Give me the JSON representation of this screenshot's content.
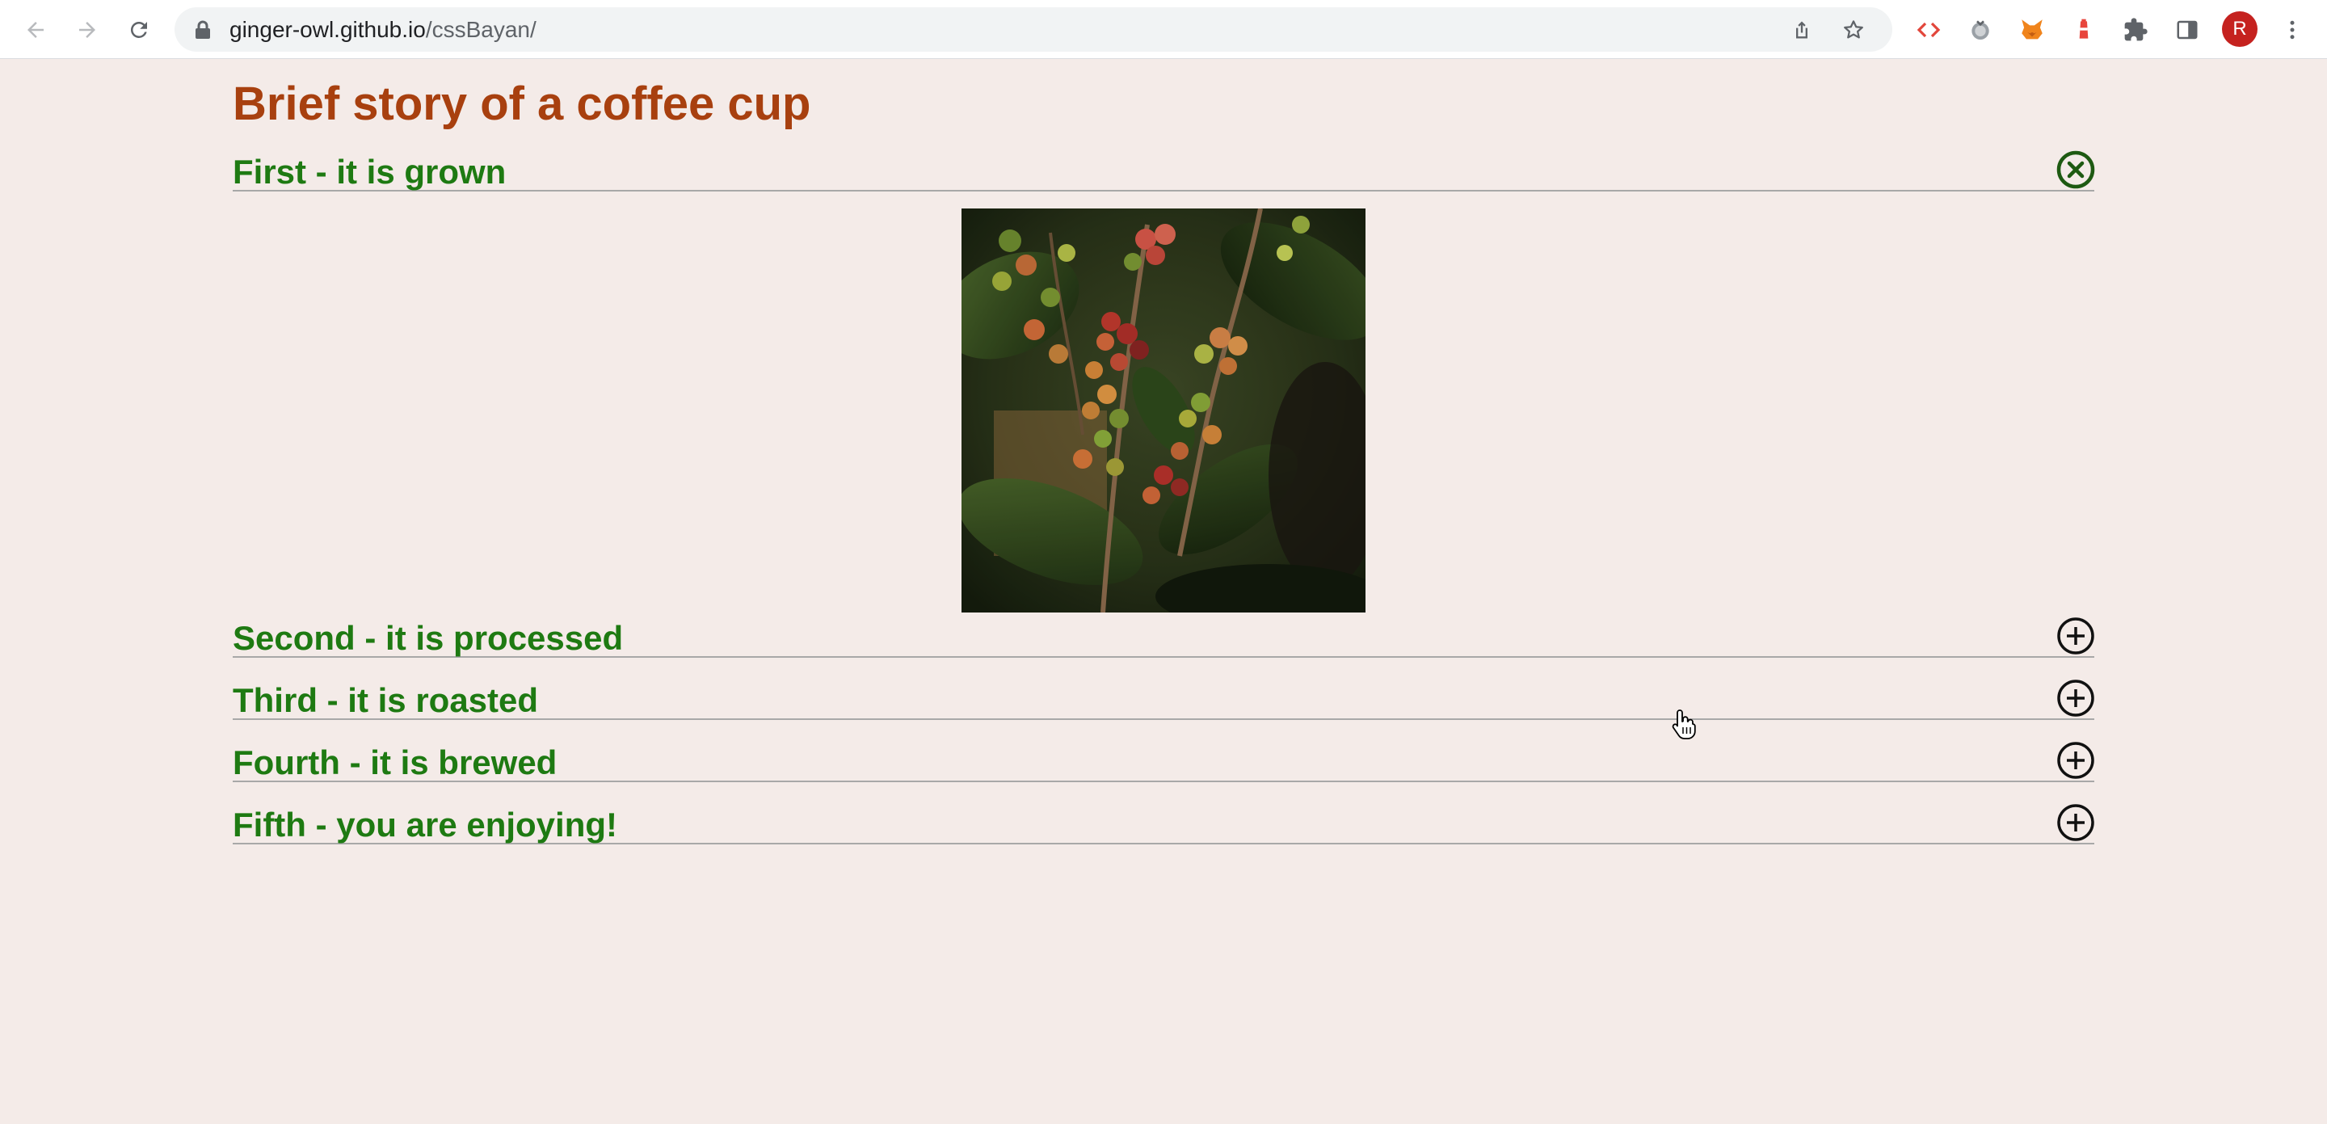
{
  "browser": {
    "url_host": "ginger-owl.github.io",
    "url_path": "/cssBayan/",
    "profile_initial": "R"
  },
  "page": {
    "title": "Brief story of a coffee cup",
    "sections": [
      {
        "title": "First - it is grown",
        "expanded": true,
        "toggle_icon": "close-circle-icon"
      },
      {
        "title": "Second - it is processed",
        "expanded": false,
        "toggle_icon": "plus-circle-icon"
      },
      {
        "title": "Third - it is roasted",
        "expanded": false,
        "toggle_icon": "plus-circle-icon"
      },
      {
        "title": "Fourth - it is brewed",
        "expanded": false,
        "toggle_icon": "plus-circle-icon"
      },
      {
        "title": "Fifth - you are enjoying!",
        "expanded": false,
        "toggle_icon": "plus-circle-icon"
      }
    ]
  },
  "colors": {
    "page_background": "#f4ebe8",
    "title": "#a8400f",
    "section_title": "#1e7a12",
    "close_icon": "#1e5a12"
  }
}
